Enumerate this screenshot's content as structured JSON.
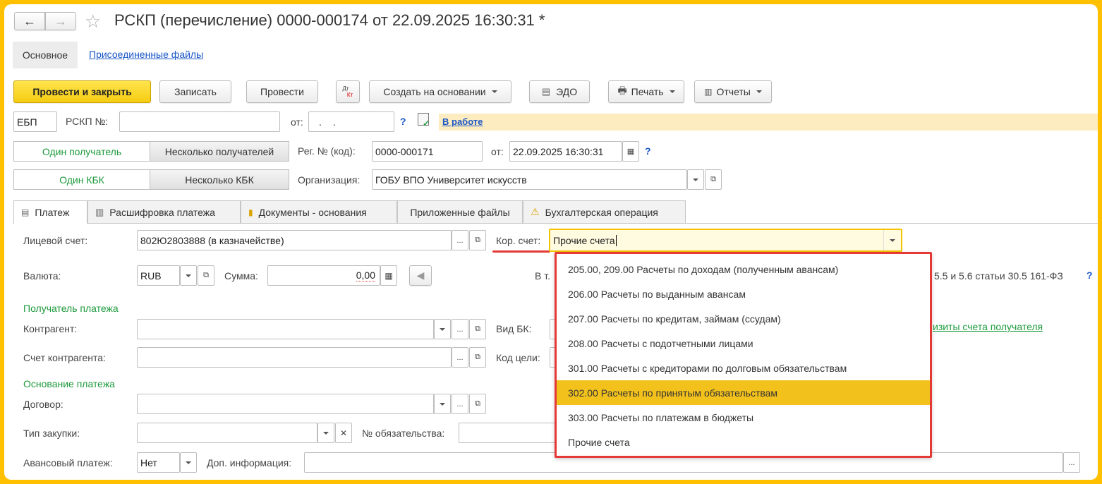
{
  "window": {
    "title": "РСКП (перечисление) 0000-000174 от 22.09.2025 16:30:31 *"
  },
  "nav": {
    "back": "←",
    "forward": "→",
    "star": "☆"
  },
  "section_tabs": [
    "Основное",
    "Присоединенные файлы"
  ],
  "toolbar": {
    "post_close": "Провести и закрыть",
    "save": "Записать",
    "post": "Провести",
    "dtkt_top": "Дт",
    "dtkt_bottom": "Кт",
    "create_based": "Создать на основании",
    "edo": "ЭДО",
    "print": "Печать",
    "reports": "Отчеты"
  },
  "header": {
    "ebp": "ЕБП",
    "rskp_label": "РСКП №:",
    "rskp_value": "",
    "from_label": "от:",
    "from_value": ". .",
    "help": "?",
    "status": "В работе"
  },
  "row2": {
    "one_recipient": "Один получатель",
    "many_recipients": "Несколько получателей",
    "reg_label": "Рег. № (код):",
    "reg_value": "0000-000171",
    "from_label": "от:",
    "date_value": "22.09.2025 16:30:31",
    "help": "?"
  },
  "row3": {
    "one_kbk": "Один КБК",
    "many_kbk": "Несколько КБК",
    "org_label": "Организация:",
    "org_value": "ГОБУ ВПО Университет искусств"
  },
  "tabs": [
    "Платеж",
    "Расшифровка платежа",
    "Документы - основания",
    "Приложенные файлы",
    "Бухгалтерская операция"
  ],
  "form": {
    "account_label": "Лицевой счет:",
    "account_value": "802Ю2803888 (в казначействе)",
    "kor_label": "Кор. счет:",
    "kor_value": "Прочие счета",
    "currency_label": "Валюта:",
    "currency_value": "RUB",
    "sum_label": "Сумма:",
    "sum_value": "0,00",
    "hidden_v_t": "В т.",
    "hidden_law": "5.5 и 5.6 статьи 30.5 161-ФЗ",
    "help": "?",
    "recipient_section": "Получатель платежа",
    "counterparty_label": "Контрагент:",
    "vid_bk_label": "Вид БК:",
    "recipient_details_link": "изиты счета получателя",
    "cp_account_label": "Счет контрагента:",
    "kod_celi_label": "Код цели:",
    "basis_section": "Основание платежа",
    "contract_label": "Договор:",
    "purchase_type_label": "Тип закупки:",
    "obligation_label": "№ обязательства:",
    "advance_label": "Авансовый платеж:",
    "advance_value": "Нет",
    "extra_info_label": "Доп. информация:",
    "dots": "..."
  },
  "dropdown": {
    "items": [
      "205.00, 209.00 Расчеты по доходам (полученным авансам)",
      "206.00 Расчеты по выданным авансам",
      "207.00 Расчеты по кредитам, займам (ссудам)",
      "208.00 Расчеты с подотчетными лицами",
      "301.00 Расчеты с кредиторами по долговым обязательствам",
      "302.00 Расчеты по принятым обязательствам",
      "303.00 Расчеты по платежам в бюджеты",
      "Прочие счета"
    ],
    "selected_index": 5
  },
  "colors": {
    "border": "#ffc000",
    "selection": "#f3c11c",
    "highlight_box": "#e53935",
    "green_text": "#1e9a3c",
    "link": "#1a56c7"
  }
}
